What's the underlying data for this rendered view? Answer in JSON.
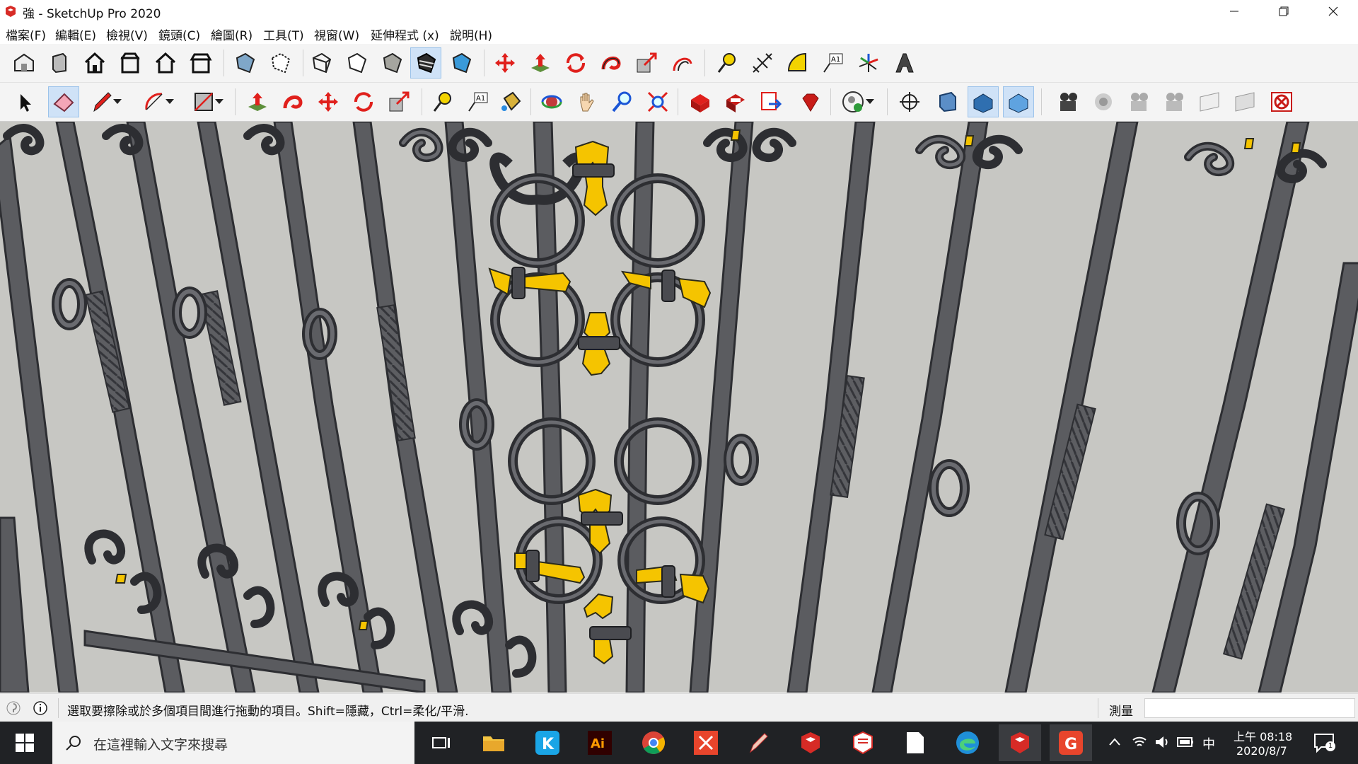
{
  "window": {
    "title": "強 - SketchUp Pro 2020",
    "minimize_icon": "minimize-icon",
    "restore_icon": "restore-icon",
    "close_icon": "close-icon"
  },
  "menu": [
    "檔案(F)",
    "編輯(E)",
    "檢視(V)",
    "鏡頭(C)",
    "繪圖(R)",
    "工具(T)",
    "視窗(W)",
    "延伸程式 (x)",
    "說明(H)"
  ],
  "toolbar_top": {
    "views": [
      "iso-view-icon",
      "top-view-icon",
      "front-view-icon",
      "right-view-icon",
      "back-view-icon",
      "left-view-icon"
    ],
    "styles": [
      "xray-icon",
      "back-edges-icon",
      "wireframe-icon",
      "hidden-line-icon",
      "shaded-icon",
      "shaded-texture-icon",
      "monochrome-icon"
    ],
    "edit": [
      "move-icon",
      "push-pull-icon",
      "rotate-icon",
      "follow-me-icon",
      "scale-icon",
      "offset-icon"
    ],
    "construction": [
      "tape-measure-icon",
      "dimension-icon",
      "protractor-icon",
      "text-icon",
      "axes-icon",
      "3d-text-icon"
    ],
    "active_style": "shaded-icon"
  },
  "toolbar_bottom": {
    "tools": [
      "select-icon",
      "eraser-icon",
      "pencil-icon",
      "arc-icon",
      "rectangle-icon",
      "push-pull-icon",
      "follow-me-icon",
      "move-icon",
      "rotate-icon",
      "scale-icon",
      "tape-measure-icon",
      "text-icon",
      "paint-bucket-icon",
      "orbit-icon",
      "pan-icon",
      "zoom-icon",
      "zoom-extents-icon",
      "3d-warehouse-icon",
      "extension-warehouse-icon",
      "layout-icon",
      "ruby-icon",
      "profile-icon",
      "position-camera-icon",
      "section-plane-icon",
      "display-section-icon",
      "section-fill-icon",
      "sandbox-icon",
      "walk-icon",
      "camera-icon",
      "look-around-icon",
      "advanced-camera-icon",
      "camera-frustum-icon",
      "hide-cameras-icon",
      "delete-camera-icon"
    ],
    "active_tool": "eraser-icon"
  },
  "accent": "#f5c400",
  "iron_color": "#55565a",
  "status": {
    "message": "選取要擦除或於多個項目間進行拖動的項目。Shift=隱藏，Ctrl=柔化/平滑.",
    "measure_label": "測量",
    "measure_value": ""
  },
  "taskbar": {
    "search_placeholder": "在這裡輸入文字來搜尋",
    "apps": [
      "task-view-icon",
      "file-explorer-icon",
      "k-app-icon",
      "illustrator-icon",
      "chrome-icon",
      "x-app-icon",
      "pen-app-icon",
      "sketchup-icon",
      "layout-icon",
      "file-icon",
      "edge-icon",
      "sketchup-active-icon",
      "g-app-icon"
    ],
    "time": "上午 08:18",
    "date": "2020/8/7",
    "ime": "中",
    "notifications": "1"
  }
}
